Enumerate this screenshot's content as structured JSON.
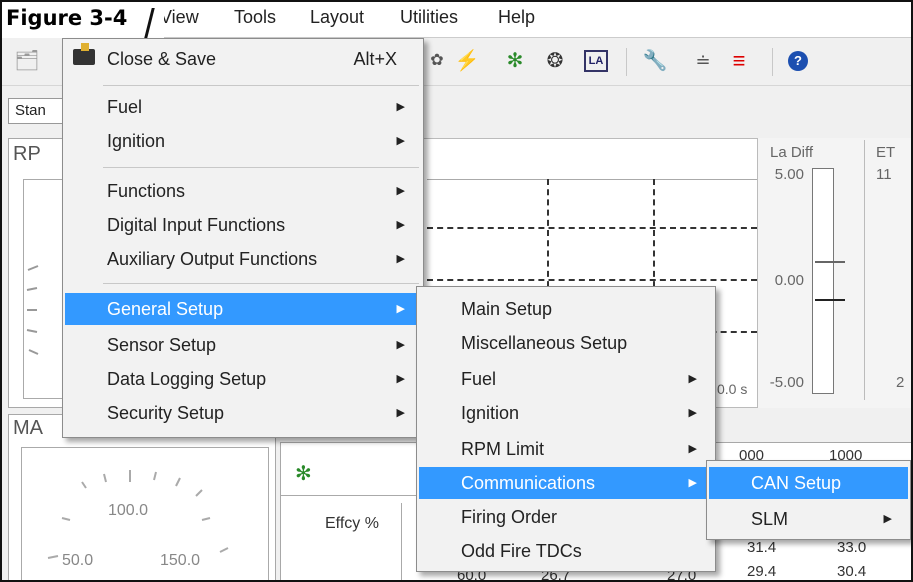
{
  "figure_label": "Figure 3-4",
  "menubar": {
    "items": [
      "View",
      "Tools",
      "Layout",
      "Utilities",
      "Help"
    ]
  },
  "toolbar": {
    "icons": [
      "open-folder-icon",
      "lightning-icon",
      "satellite-icon",
      "turbo-icon",
      "la-icon",
      "wrench-icon",
      "graph-icon",
      "red-lines-icon",
      "help-icon"
    ],
    "la_text": "LA"
  },
  "tab": {
    "label": "Stan"
  },
  "gauges": {
    "rpm_title": "RP",
    "map_title": "MA",
    "map_ticks": [
      "100.0",
      "50.0",
      "150.0"
    ]
  },
  "chart": {
    "time_label": "0.0 s"
  },
  "bar_gauges": {
    "la_diff": {
      "label": "La Diff",
      "top": "5.00",
      "mid": "0.00",
      "bottom": "-5.00"
    },
    "et": {
      "label": "ET",
      "top": "11",
      "bottom": "2"
    }
  },
  "table": {
    "header": "Effcy %",
    "col_headers": [
      "000",
      "1000"
    ],
    "rows": [
      [
        "31.4",
        "33.0"
      ],
      [
        "29.4",
        "30.4"
      ]
    ],
    "partial_row": [
      "60.0",
      "26.7",
      "27.0"
    ]
  },
  "main_menu": {
    "items": [
      {
        "label": "Close & Save",
        "shortcut": "Alt+X",
        "icon": "folder-save-icon"
      },
      {
        "label": "Fuel",
        "submenu": true
      },
      {
        "label": "Ignition",
        "submenu": true
      },
      {
        "label": "Functions",
        "submenu": true
      },
      {
        "label": "Digital Input Functions",
        "submenu": true
      },
      {
        "label": "Auxiliary Output Functions",
        "submenu": true
      },
      {
        "label": "General Setup",
        "submenu": true,
        "highlighted": true
      },
      {
        "label": "Sensor Setup",
        "submenu": true
      },
      {
        "label": "Data Logging Setup",
        "submenu": true
      },
      {
        "label": "Security Setup",
        "submenu": true
      }
    ]
  },
  "general_setup_menu": {
    "items": [
      {
        "label": "Main Setup"
      },
      {
        "label": "Miscellaneous Setup"
      },
      {
        "label": "Fuel",
        "submenu": true
      },
      {
        "label": "Ignition",
        "submenu": true
      },
      {
        "label": "RPM Limit",
        "submenu": true
      },
      {
        "label": "Communications",
        "submenu": true,
        "highlighted": true
      },
      {
        "label": "Firing Order"
      },
      {
        "label": "Odd Fire TDCs"
      }
    ]
  },
  "communications_menu": {
    "items": [
      {
        "label": "CAN Setup",
        "highlighted": true
      },
      {
        "label": "SLM",
        "submenu": true
      }
    ]
  },
  "colors": {
    "highlight": "#3399ff",
    "accent_red": "#dd0000"
  }
}
